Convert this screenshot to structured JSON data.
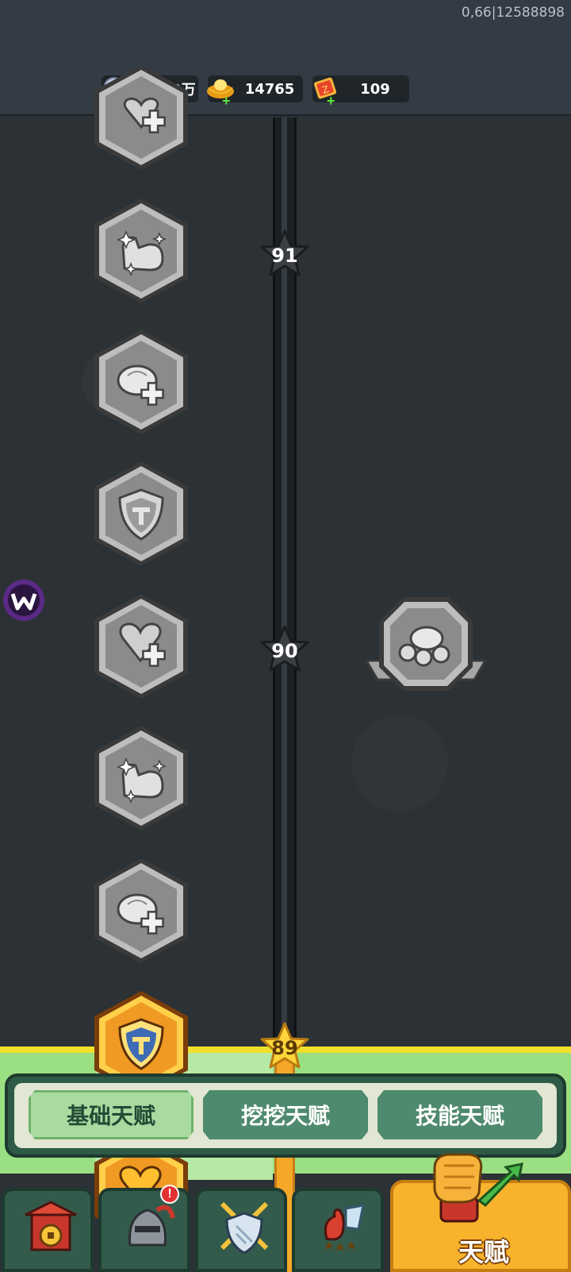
{
  "version_text": "0,66|12588898",
  "resources": [
    {
      "name": "silver-coin",
      "value": "1633.9万",
      "color": "#aab8d0"
    },
    {
      "name": "gold-ingot",
      "value": "14765",
      "color": "#f5c120"
    },
    {
      "name": "ticket",
      "value": "109",
      "color": "#f56a2a"
    }
  ],
  "track": {
    "levels": [
      {
        "label": "91",
        "state": "locked"
      },
      {
        "label": "90",
        "state": "locked"
      },
      {
        "label": "89",
        "state": "reached"
      }
    ]
  },
  "talent_nodes": [
    {
      "icon": "heart-plus-icon",
      "state": "locked"
    },
    {
      "icon": "muscle-arm-icon",
      "state": "locked"
    },
    {
      "icon": "bun-plus-icon",
      "state": "locked"
    },
    {
      "icon": "shield-icon",
      "state": "locked"
    },
    {
      "icon": "heart-plus-icon",
      "state": "locked"
    },
    {
      "icon": "muscle-arm-icon",
      "state": "locked"
    },
    {
      "icon": "bun-plus-icon",
      "state": "locked"
    },
    {
      "icon": "shield-icon",
      "state": "unlocked"
    },
    {
      "icon": "heart-plus-icon",
      "state": "unlocked"
    }
  ],
  "special_node": {
    "icon": "bun-pile-icon",
    "state": "locked"
  },
  "tabs": [
    {
      "label": "基础天赋",
      "active": true
    },
    {
      "label": "挖挖天赋",
      "active": false
    },
    {
      "label": "技能天赋",
      "active": false
    }
  ],
  "bottom_nav": {
    "items": [
      {
        "icon": "gate-icon"
      },
      {
        "icon": "knight-helmet-icon",
        "badge": "!"
      },
      {
        "icon": "crossed-swords-shield-icon"
      },
      {
        "icon": "rooster-stars-icon"
      }
    ],
    "main_label": "天赋"
  },
  "colors": {
    "locked_node": "#8e8e8e",
    "unlocked_node": "#f4a62a",
    "accent_green": "#9adf82",
    "track_yellow": "#f1e02b"
  }
}
